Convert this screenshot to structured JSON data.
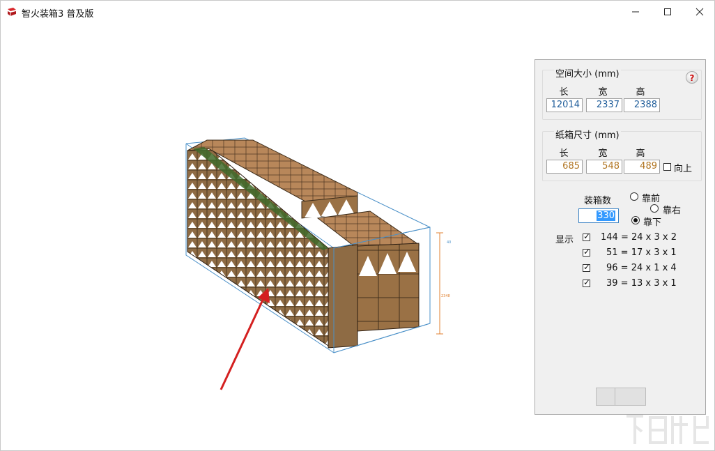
{
  "window": {
    "title": "智火装箱3 普及版",
    "min_icon": "minimize-icon",
    "max_icon": "maximize-icon",
    "close_icon": "close-icon"
  },
  "viewport": {
    "dim_label_top": "40",
    "dim_label_height": "2348"
  },
  "panel": {
    "space_group": {
      "title": "空间大小 (mm)",
      "len_label": "长",
      "wid_label": "宽",
      "hei_label": "高",
      "length": "12014",
      "width": "2337",
      "height": "2388"
    },
    "carton_group": {
      "title": "纸箱尺寸 (mm)",
      "len_label": "长",
      "wid_label": "宽",
      "hei_label": "高",
      "length": "685",
      "width": "548",
      "height": "489",
      "upright_label": "向上"
    },
    "count_label": "装箱数",
    "count_value": "330",
    "align_front": "靠前",
    "align_right": "靠右",
    "align_bottom": "靠下",
    "show_label": "显示",
    "combos": [
      "144 = 24 x 3 x 2",
      " 51 = 17 x 3 x 1",
      " 96 = 24 x 1 x 4",
      " 39 = 13 x 3 x 1"
    ]
  },
  "colors": {
    "box_top": "#c49a6c",
    "box_side": "#8b6a45",
    "frame": "#4a90c8",
    "arrow": "#d42020",
    "space_value": "#1f5d9a",
    "carton_value": "#b07420"
  }
}
